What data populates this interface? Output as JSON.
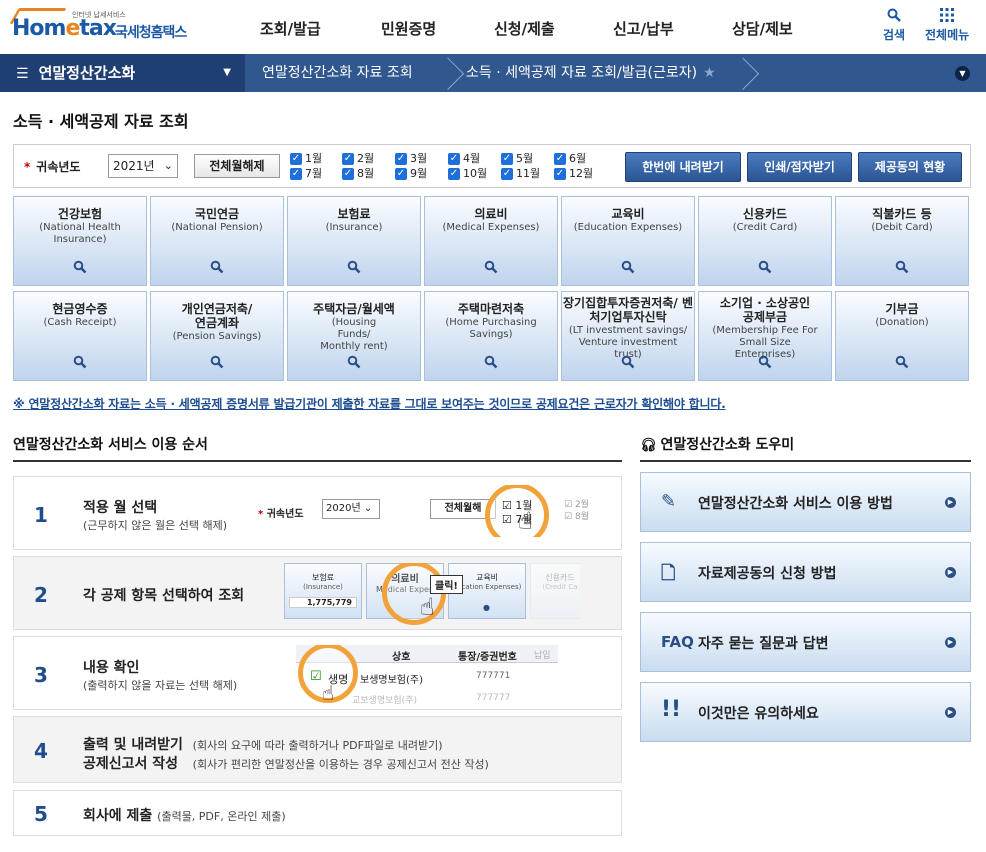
{
  "header": {
    "logo_small": "인터넷 납세서비스",
    "logo_home": "Hom",
    "logo_e": "e",
    "logo_tax": "tax",
    "logo_kr": "국세청홈택스",
    "nav": [
      "조회/발급",
      "민원증명",
      "신청/제출",
      "신고/납부",
      "상담/제보"
    ],
    "search_label": "검색",
    "menu_label": "전체메뉴"
  },
  "breadcrumb": {
    "main": "연말정산간소화",
    "item1": "연말정산간소화 자료 조회",
    "item2": "소득 · 세액공제 자료 조회/발급(근로자)"
  },
  "page_title": "소득 · 세액공제 자료 조회",
  "filter": {
    "label": "귀속년도",
    "year": "2021년",
    "clear_all": "전체월해제",
    "months_row1": [
      "1월",
      "2월",
      "3월",
      "4월",
      "5월",
      "6월"
    ],
    "months_row2": [
      "7월",
      "8월",
      "9월",
      "10월",
      "11월",
      "12월"
    ],
    "download_all": "한번에 내려받기",
    "print": "인쇄/점자받기",
    "status": "제공동의 현황"
  },
  "categories": [
    {
      "kr": "건강보험",
      "en": "(National Health Insurance)"
    },
    {
      "kr": "국민연금",
      "en": "(National Pension)"
    },
    {
      "kr": "보험료",
      "en": "(Insurance)"
    },
    {
      "kr": "의료비",
      "en": "(Medical Expenses)"
    },
    {
      "kr": "교육비",
      "en": "(Education Expenses)"
    },
    {
      "kr": "신용카드",
      "en": "(Credit Card)"
    },
    {
      "kr": "직불카드 등",
      "en": "(Debit Card)"
    },
    {
      "kr": "현금영수증",
      "en": "(Cash Receipt)"
    },
    {
      "kr": "개인연금저축/ 연금계좌",
      "en": "(Pension Savings)"
    },
    {
      "kr": "주택자금/월세액",
      "en": "(Housing Funds/ Monthly rent)"
    },
    {
      "kr": "주택마련저축",
      "en": "(Home Purchasing Savings)"
    },
    {
      "kr": "장기집합투자증권저축/ 벤처기업투자신탁",
      "en": "(LT investment savings/ Venture investment trust)"
    },
    {
      "kr": "소기업 · 소상공인 공제부금",
      "en": "(Membership Fee For Small Size Enterprises)"
    },
    {
      "kr": "기부금",
      "en": "(Donation)"
    }
  ],
  "notice": "※ 연말정산간소화 자료는 소득 · 세액공제 증명서류 발급기관이 제출한 자료를 그대로 보여주는 것이므로 공제요건은 근로자가 확인해야 합니다.",
  "order": {
    "title": "연말정산간소화 서비스 이용 순서",
    "steps": [
      {
        "num": "1",
        "title": "적용 월 선택",
        "sub": "(근무하지 않은 월은 선택 해제)"
      },
      {
        "num": "2",
        "title": "각 공제 항목 선택하여 조회",
        "sub": ""
      },
      {
        "num": "3",
        "title": "내용 확인",
        "sub": "(출력하지 않을 자료는 선택 해제)"
      },
      {
        "num": "4",
        "title": "출력 및 내려받기",
        "sub": "(회사의 요구에 따라 출력하거나 PDF파일로 내려받기)",
        "title2": "공제신고서 작성",
        "sub2": "(회사가 편리한 연말정산을 이용하는 경우 공제신고서 전산 작성)"
      },
      {
        "num": "5",
        "title": "회사에 제출",
        "sub": "(출력물, PDF, 온라인 제출)"
      }
    ],
    "mock1": {
      "label": "귀속년도",
      "year": "2020년",
      "clear": "전체월해",
      "m1": "1월",
      "m2": "2월",
      "m7": "7월",
      "m8": "8월"
    },
    "mock2": {
      "c1_kr": "보험료",
      "c1_en": "(Insurance)",
      "c1_val": "1,775,779",
      "c2_kr": "의료비",
      "c2_en": "Medical Expen",
      "c3_kr": "교육비",
      "c3_en": "ducation Expenses)",
      "c4_kr": "신용카드",
      "c4_en": "(Credit Ca",
      "click": "클릭!"
    },
    "mock3": {
      "h1": "상호",
      "h2": "통장/증권번호",
      "h3": "납입",
      "row_label": "생명",
      "row_company": "보생명보험(주)",
      "row_no": "777771",
      "row2": "교보생명보험(주)",
      "row2_no": "777777"
    }
  },
  "helper": {
    "title": "연말정산간소화 도우미",
    "items": [
      "연말정산간소화 서비스 이용 방법",
      "자료제공동의 신청 방법",
      "자주 묻는 질문과 답변",
      "이것만은 유의하세요"
    ],
    "faq_icon": "FAQ"
  },
  "colors": {
    "brand": "#1d5aa6",
    "nav_dark": "#1f3f72",
    "nav": "#30588f",
    "accent": "#e8841e",
    "ring": "#f1a23a"
  }
}
